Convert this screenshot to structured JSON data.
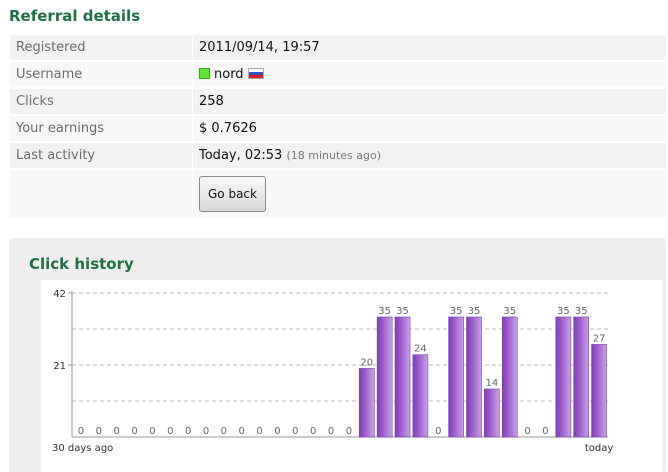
{
  "details": {
    "title": "Referral details",
    "rows": [
      {
        "label": "Registered",
        "value": "2011/09/14, 19:57"
      },
      {
        "label": "Username",
        "value": "nord"
      },
      {
        "label": "Clicks",
        "value": "258"
      },
      {
        "label": "Your earnings",
        "value": "$ 0.7626"
      },
      {
        "label": "Last activity",
        "value": "Today, 02:53",
        "note": "(18 minutes ago)"
      }
    ],
    "go_back_label": "Go back",
    "status_color": "#5fe236",
    "flag_icon": "russia-flag-icon"
  },
  "history": {
    "title": "Click history"
  },
  "chart_data": {
    "type": "bar",
    "categories": [
      "30 days ago",
      "",
      "",
      "",
      "",
      "",
      "",
      "",
      "",
      "",
      "",
      "",
      "",
      "",
      "",
      "",
      "",
      "",
      "",
      "",
      "",
      "",
      "",
      "",
      "",
      "",
      "",
      "",
      "",
      "today"
    ],
    "values": [
      0,
      0,
      0,
      0,
      0,
      0,
      0,
      0,
      0,
      0,
      0,
      0,
      0,
      0,
      0,
      0,
      20,
      35,
      35,
      24,
      0,
      35,
      35,
      14,
      35,
      0,
      0,
      35,
      35,
      27
    ],
    "ylim": [
      0,
      42
    ],
    "yticks": [
      21,
      42
    ],
    "xlabel_start": "30 days ago",
    "xlabel_end": "today",
    "grid": true,
    "bar_color": "#9b59c9"
  }
}
